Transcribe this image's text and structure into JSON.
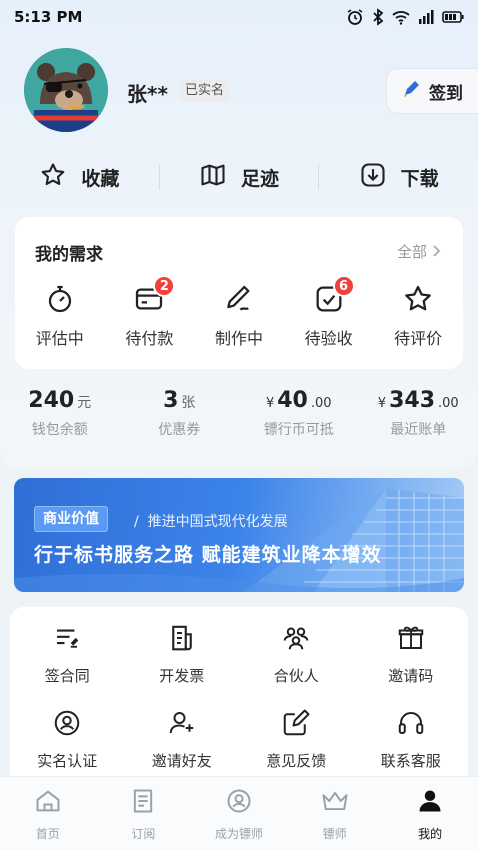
{
  "status": {
    "time": "5:13 PM"
  },
  "user": {
    "name": "张**",
    "verified_label": "已实名",
    "checkin_label": "签到"
  },
  "quick": [
    {
      "label": "收藏",
      "icon": "star-icon"
    },
    {
      "label": "足迹",
      "icon": "map-icon"
    },
    {
      "label": "下载",
      "icon": "download-icon"
    }
  ],
  "needs": {
    "title": "我的需求",
    "all_label": "全部",
    "items": [
      {
        "label": "评估中",
        "icon": "stopwatch-icon",
        "badge": ""
      },
      {
        "label": "待付款",
        "icon": "card-icon",
        "badge": "2"
      },
      {
        "label": "制作中",
        "icon": "pencil-icon",
        "badge": ""
      },
      {
        "label": "待验收",
        "icon": "check-box-icon",
        "badge": "6"
      },
      {
        "label": "待评价",
        "icon": "star-icon",
        "badge": ""
      }
    ]
  },
  "stats": [
    {
      "prefix": "",
      "value": "240",
      "decimal": "",
      "unit": "元",
      "label": "钱包余额"
    },
    {
      "prefix": "",
      "value": "3",
      "decimal": "",
      "unit": "张",
      "label": "优惠券"
    },
    {
      "prefix": "¥",
      "value": "40",
      "decimal": ".00",
      "unit": "",
      "label": "镖行币可抵"
    },
    {
      "prefix": "¥",
      "value": "343",
      "decimal": ".00",
      "unit": "",
      "label": "最近账单"
    }
  ],
  "banner": {
    "tag": "商业价值",
    "subtitle": "推进中国式现代化发展",
    "headline": "行于标书服务之路  赋能建筑业降本增效"
  },
  "services": [
    {
      "label": "签合同",
      "icon": "contract-icon"
    },
    {
      "label": "开发票",
      "icon": "invoice-icon"
    },
    {
      "label": "合伙人",
      "icon": "partners-icon"
    },
    {
      "label": "邀请码",
      "icon": "gift-icon"
    },
    {
      "label": "实名认证",
      "icon": "id-verify-icon"
    },
    {
      "label": "邀请好友",
      "icon": "add-friend-icon"
    },
    {
      "label": "意见反馈",
      "icon": "feedback-icon"
    },
    {
      "label": "联系客服",
      "icon": "headset-icon"
    }
  ],
  "tabs": [
    {
      "label": "首页",
      "icon": "home-icon",
      "active": false
    },
    {
      "label": "订阅",
      "icon": "subscribe-icon",
      "active": false
    },
    {
      "label": "成为镖师",
      "icon": "become-escort-icon",
      "active": false
    },
    {
      "label": "镖师",
      "icon": "crown-icon",
      "active": false
    },
    {
      "label": "我的",
      "icon": "profile-icon",
      "active": true
    }
  ],
  "colors": {
    "accent": "#2f6fd6",
    "badge": "#f0413b",
    "background": "#eef3f8"
  }
}
